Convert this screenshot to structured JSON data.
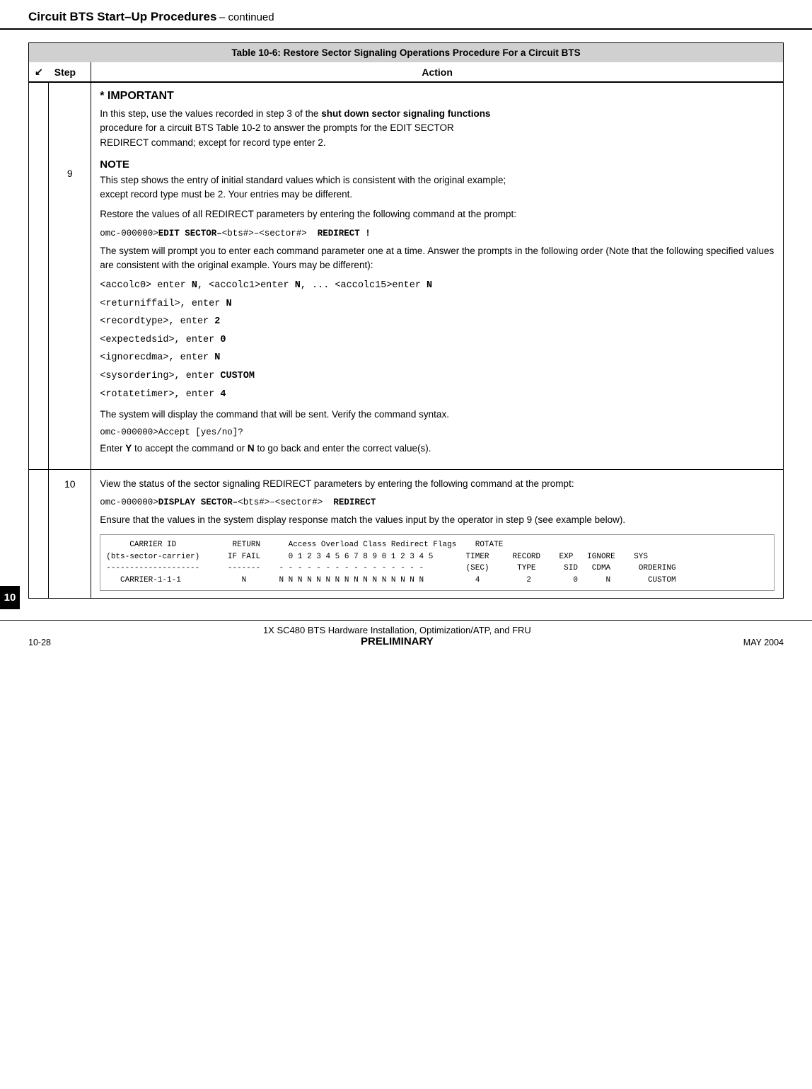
{
  "header": {
    "title": "Circuit BTS Start–Up Procedures",
    "subtitle": "– continued"
  },
  "table": {
    "caption": "Table 10-6: Restore Sector Signaling Operations Procedure For a Circuit BTS",
    "col_step": "Step",
    "col_action": "Action"
  },
  "step9": {
    "number": "9",
    "important_title": "* IMPORTANT",
    "important_text": "In this step, use the values recorded in step 3 of the shut down sector signaling functions procedure for a circuit BTS Table 10-2 to answer the prompts for the EDIT SECTOR REDIRECT command; except for record type enter 2.",
    "note_title": "NOTE",
    "note_text": "This step shows the entry of initial standard values which is consistent with the original example; except record type must be 2. Your entries may be different.",
    "restore_text": "Restore the values of all REDIRECT parameters by entering the following command at the prompt:",
    "command1_prefix": "omc-000000>",
    "command1_bold": "EDIT SECTOR–",
    "command1_mid": "<bts#>–<sector#>",
    "command1_suffix": "  REDIRECT !",
    "prompt_intro": "The system will prompt you to enter each command parameter one at a time. Answer the prompts in the following order (Note that the following specified values are consistent with the original example. Yours may be different):",
    "param_lines": [
      "<accolc0> enter N, <accolc1>enter N, ...  <accolc15>enter N",
      "<returniffail>, enter N",
      "<recordtype>, enter 2",
      "<expectedsid>, enter 0",
      "<ignorecdma>, enter N",
      "<sysordering>, enter CUSTOM",
      "<rotatetimer>, enter 4"
    ],
    "param_bold_parts": [
      {
        "line": 0,
        "bold": "N"
      },
      {
        "line": 1,
        "bold": "N"
      },
      {
        "line": 2,
        "bold": "2"
      },
      {
        "line": 3,
        "bold": "0"
      },
      {
        "line": 4,
        "bold": "N"
      },
      {
        "line": 5,
        "bold": "CUSTOM"
      },
      {
        "line": 6,
        "bold": "4"
      }
    ],
    "verify_text": "The system will display the command that will be sent. Verify the command syntax.",
    "command2": "omc-000000>Accept [yes/no]?",
    "enter_y_text_pre": "Enter ",
    "enter_y_bold": "Y",
    "enter_y_mid": " to accept the command or ",
    "enter_y_bold2": "N",
    "enter_y_post": " to go back and enter the correct value(s)."
  },
  "step10": {
    "number": "10",
    "view_text": "View the status of the sector signaling REDIRECT parameters by entering the following command at the prompt:",
    "command_prefix": "omc-000000>",
    "command_bold": "DISPLAY SECTOR–",
    "command_mid": "<bts#>–<sector#>",
    "command_suffix": "  REDIRECT",
    "ensure_text": "Ensure that the values in the system display response match the values input by the operator in step 9 (see example below).",
    "data_table": "     CARRIER ID            RETURN      Access Overload Class Redirect Flags    ROTATE\n(bts-sector-carrier)      IF FAIL      0 1 2 3 4 5 6 7 8 9 0 1 2 3 4 5       TIMER     RECORD    EXP   IGNORE    SYS\n--------------------      -------    - - - - - - - - - - - - - - - -        (SEC)      TYPE      SID   CDMA      ORDERING\n   CARRIER-1-1-1             N       N N N N N N N N N N N N N N N N          4          2         0      N        CUSTOM"
  },
  "footer": {
    "page_left": "10-28",
    "page_center_main": "1X SC480 BTS Hardware Installation, Optimization/ATP, and FRU",
    "page_center_sub": "PRELIMINARY",
    "page_right": "MAY 2004",
    "page_number": "10"
  }
}
